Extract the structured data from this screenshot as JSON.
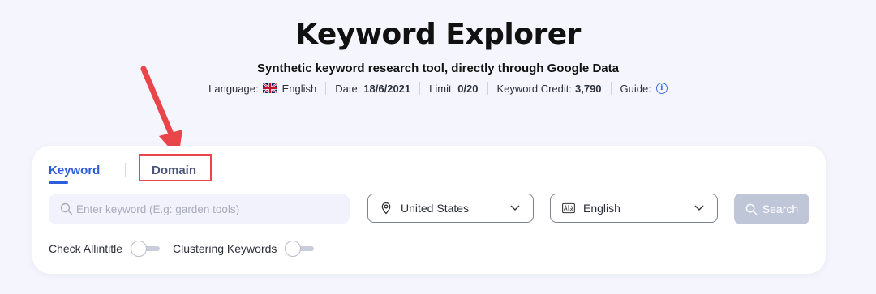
{
  "header": {
    "title": "Keyword Explorer",
    "subtitle": "Synthetic keyword research tool, directly through Google Data"
  },
  "meta": {
    "language_label": "Language:",
    "language_value": "English",
    "language_flag": "uk-flag-icon",
    "date_label": "Date:",
    "date_value": "18/6/2021",
    "limit_label": "Limit:",
    "limit_value": "0/20",
    "credit_label": "Keyword Credit:",
    "credit_value": "3,790",
    "guide_label": "Guide:",
    "guide_icon": "info-icon"
  },
  "tabs": {
    "keyword": "Keyword",
    "domain": "Domain",
    "active": "keyword"
  },
  "search": {
    "placeholder": "Enter keyword (E.g: garden tools)",
    "value": "",
    "button_label": "Search"
  },
  "selects": {
    "country": "United States",
    "language": "English"
  },
  "toggles": {
    "allintitle_label": "Check Allintitle",
    "allintitle_on": false,
    "clustering_label": "Clustering Keywords",
    "clustering_on": false
  },
  "colors": {
    "accent": "#2f5fd8",
    "annotation": "#e8464b",
    "background": "#f5f6fd"
  }
}
